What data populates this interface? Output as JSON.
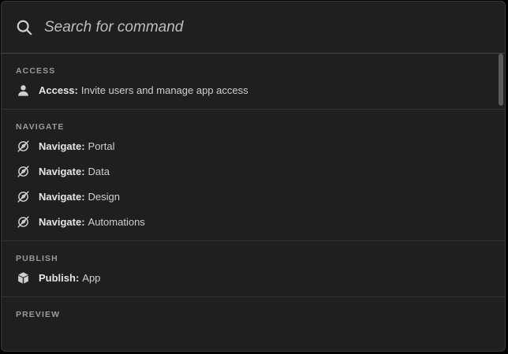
{
  "search": {
    "placeholder": "Search for command"
  },
  "sections": {
    "access": {
      "title": "ACCESS",
      "items": [
        {
          "bold": "Access:",
          "text": "Invite users and manage app access",
          "icon": "user-icon"
        }
      ]
    },
    "navigate": {
      "title": "NAVIGATE",
      "items": [
        {
          "bold": "Navigate:",
          "text": "Portal",
          "icon": "compass-off-icon"
        },
        {
          "bold": "Navigate:",
          "text": "Data",
          "icon": "compass-off-icon"
        },
        {
          "bold": "Navigate:",
          "text": "Design",
          "icon": "compass-off-icon"
        },
        {
          "bold": "Navigate:",
          "text": "Automations",
          "icon": "compass-off-icon"
        }
      ]
    },
    "publish": {
      "title": "PUBLISH",
      "items": [
        {
          "bold": "Publish:",
          "text": "App",
          "icon": "box-icon"
        }
      ]
    },
    "preview": {
      "title": "PREVIEW"
    }
  }
}
